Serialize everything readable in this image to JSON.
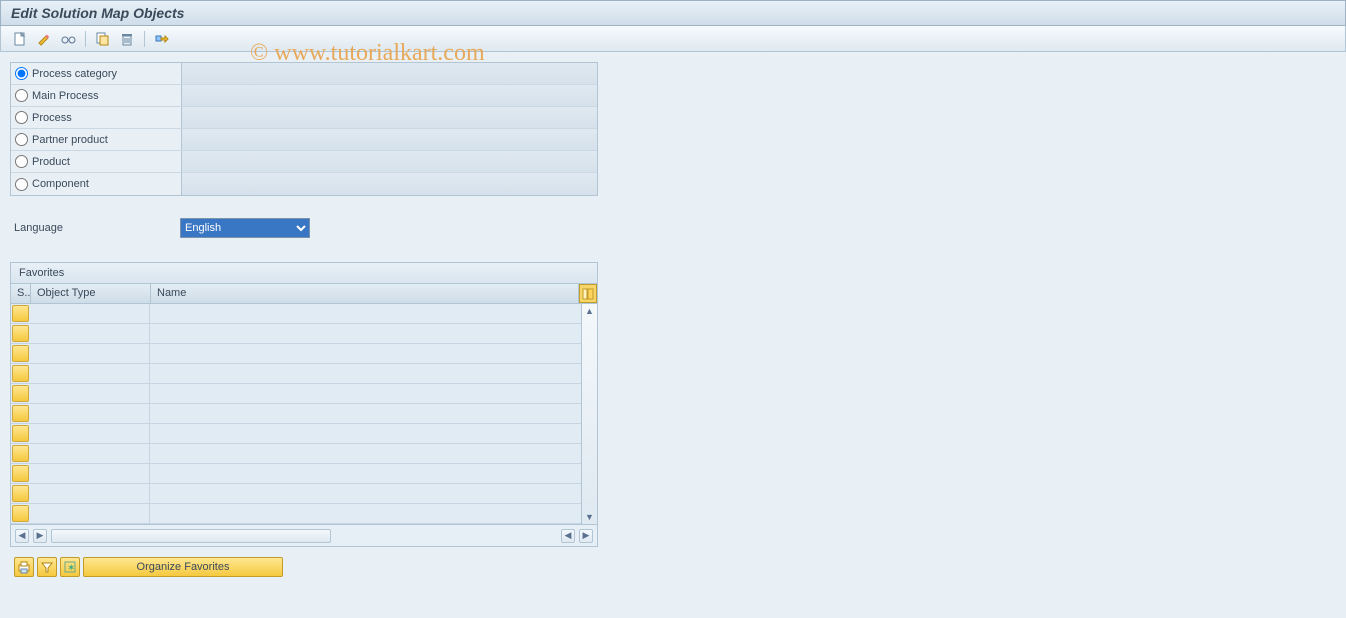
{
  "title": "Edit Solution Map Objects",
  "watermark": "© www.tutorialkart.com",
  "radios": [
    {
      "key": "process_category",
      "label": "Process category",
      "checked": true
    },
    {
      "key": "main_process",
      "label": "Main Process",
      "checked": false
    },
    {
      "key": "process",
      "label": "Process",
      "checked": false
    },
    {
      "key": "partner_product",
      "label": "Partner product",
      "checked": false
    },
    {
      "key": "product",
      "label": "Product",
      "checked": false
    },
    {
      "key": "component",
      "label": "Component",
      "checked": false
    }
  ],
  "language_label": "Language",
  "language_value": "English",
  "favorites": {
    "title": "Favorites",
    "columns": {
      "s": "S..",
      "object_type": "Object Type",
      "name": "Name"
    },
    "rows": 11
  },
  "organize_btn": "Organize Favorites"
}
